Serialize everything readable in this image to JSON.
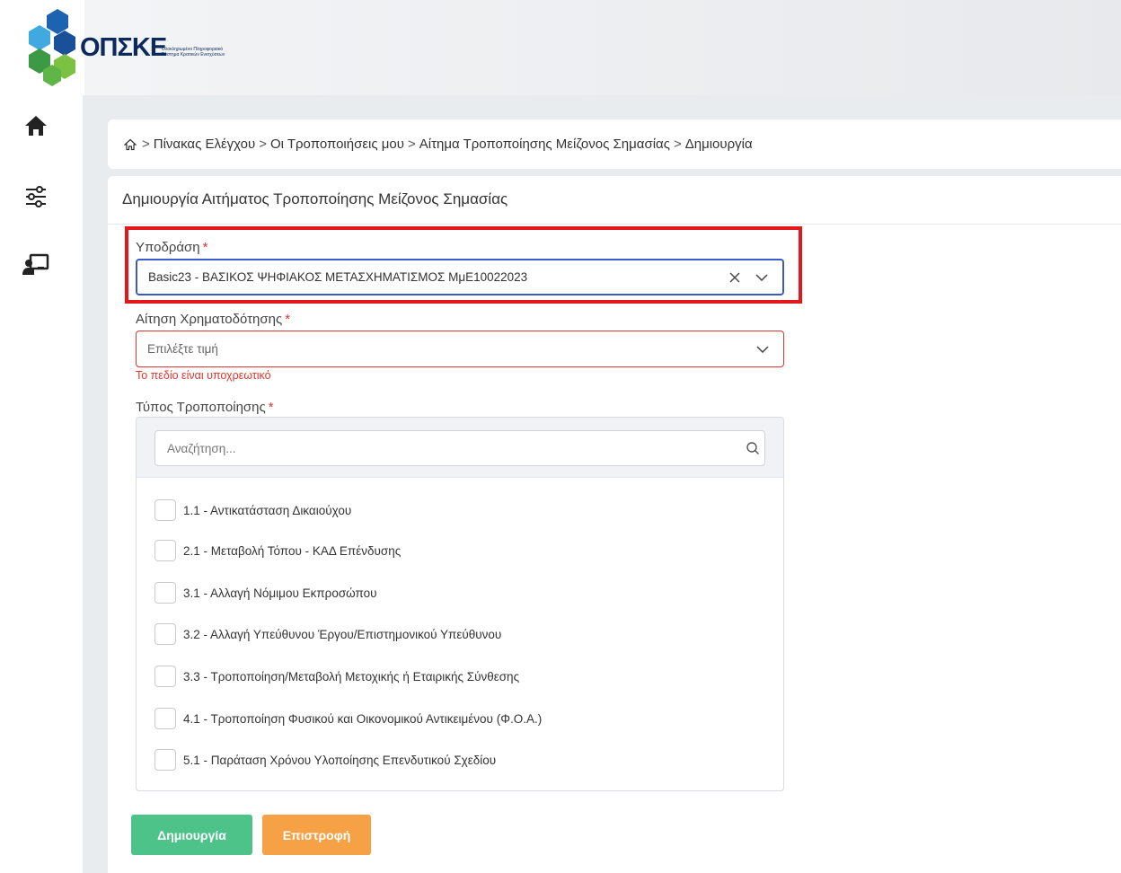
{
  "brand": {
    "name": "ΟΠΣΚΕ",
    "subtitle": "Ολοκληρωμένο Πληροφοριακό Σύστημα Κρατικών Ενισχύσεων",
    "colors": {
      "blue": "#1e63b0",
      "lightblue": "#3fa9e0",
      "green": "#7cc242",
      "darkgreen": "#3d9a44",
      "navy": "#0b2a5b"
    }
  },
  "sidebar": {
    "items": [
      {
        "icon": "home-icon"
      },
      {
        "icon": "sliders-icon"
      },
      {
        "icon": "presentation-icon"
      }
    ]
  },
  "breadcrumb": {
    "home_icon": "home-outline-icon",
    "separator": ">",
    "items": [
      "Πίνακας Ελέγχου",
      "Οι Τροποποιήσεις μου",
      "Αίτημα Τροποποίησης Μείζονος Σημασίας",
      "Δημιουργία"
    ]
  },
  "form": {
    "title": "Δημιουργία Αιτήματος Τροποποίησης Μείζονος Σημασίας",
    "required_mark": "*",
    "subaction": {
      "label": "Υποδράση",
      "value": "Basic23 - ΒΑΣΙΚΟΣ ΨΗΦΙΑΚΟΣ ΜΕΤΑΣΧΗΜΑΤΙΣΜΟΣ ΜμΕ10022023"
    },
    "funding_application": {
      "label": "Αίτηση Χρηματοδότησης",
      "placeholder": "Επιλέξτε τιμή",
      "error": "Το πεδίο είναι υποχρεωτικό"
    },
    "modification_type": {
      "label": "Τύπος Τροποποίησης",
      "search_placeholder": "Αναζήτηση...",
      "options": [
        "1.1 - Αντικατάσταση Δικαιούχου",
        "2.1 - Μεταβολή Τόπου - ΚΑΔ Επένδυσης",
        "3.1 - Αλλαγή Νόμιμου Εκπροσώπου",
        "3.2 - Αλλαγή Υπεύθυνου Έργου/Επιστημονικού Υπεύθυνου",
        "3.3 - Τροποποίηση/Μεταβολή Μετοχικής ή Εταιρικής Σύνθεσης",
        "4.1 - Τροποποίηση Φυσικού και Οικονομικού Αντικειμένου (Φ.Ο.Α.)",
        "5.1 - Παράταση Χρόνου Υλοποίησης Επενδυτικού Σχεδίου"
      ]
    },
    "buttons": {
      "create": "Δημιουργία",
      "back": "Επιστροφή"
    }
  },
  "accent_colors": {
    "highlight": "#e3181b",
    "error": "#e3342f",
    "focus": "#3b5cc6",
    "create": "#4dc38a",
    "back": "#f7a146"
  }
}
